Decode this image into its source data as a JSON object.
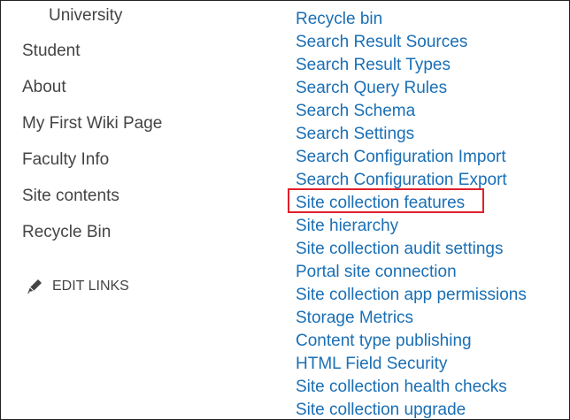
{
  "left_nav": {
    "items": [
      {
        "label": "University",
        "child": true
      },
      {
        "label": "Student",
        "child": false
      },
      {
        "label": "About",
        "child": false
      },
      {
        "label": "My First Wiki Page",
        "child": false
      },
      {
        "label": "Faculty Info",
        "child": false
      },
      {
        "label": "Site contents",
        "child": false
      },
      {
        "label": "Recycle Bin",
        "child": false
      }
    ],
    "edit_links_label": "EDIT LINKS",
    "edit_icon": "pencil-icon"
  },
  "site_settings_links": [
    "Recycle bin",
    "Search Result Sources",
    "Search Result Types",
    "Search Query Rules",
    "Search Schema",
    "Search Settings",
    "Search Configuration Import",
    "Search Configuration Export",
    "Site collection features",
    "Site hierarchy",
    "Site collection audit settings",
    "Portal site connection",
    "Site collection app permissions",
    "Storage Metrics",
    "Content type publishing",
    "HTML Field Security",
    "Site collection health checks",
    "Site collection upgrade"
  ],
  "highlighted_link": "Site collection features",
  "colors": {
    "link": "#1a6fb5",
    "nav_text": "#444444",
    "highlight_border": "#e0202a"
  }
}
